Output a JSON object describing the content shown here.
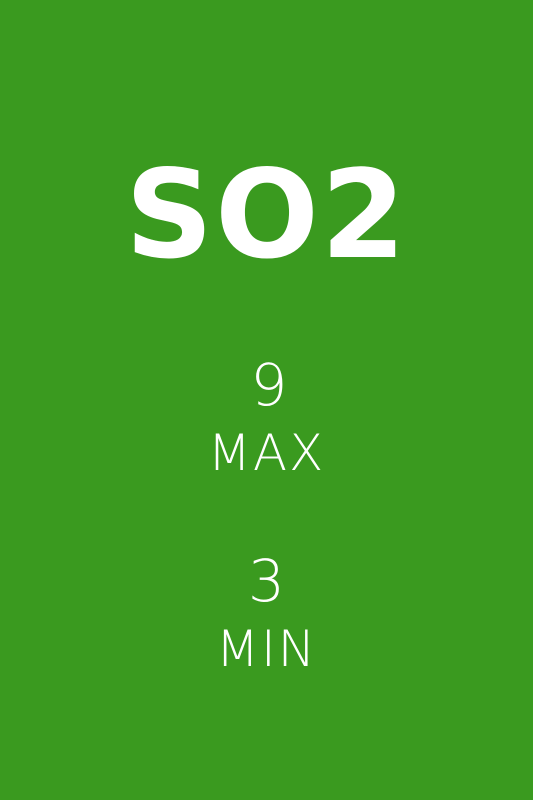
{
  "gauge": {
    "title": "SO2",
    "max": {
      "value": "9",
      "label": "MAX"
    },
    "min": {
      "value": "3",
      "label": "MIN"
    }
  },
  "colors": {
    "background": "#3a9a1f",
    "text": "#ffffff"
  }
}
